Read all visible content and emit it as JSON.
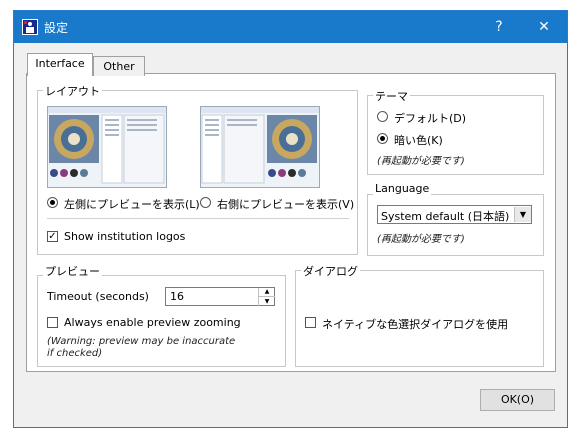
{
  "window": {
    "title": "設定",
    "help_label": "?",
    "close_label": "✕"
  },
  "tabs": [
    {
      "label": "Interface",
      "active": true
    },
    {
      "label": "Other",
      "active": false
    }
  ],
  "layout": {
    "legend": "レイアウト",
    "option_left": "左側にプレビューを表示(L)",
    "option_right": "右側にプレビューを表示(V)",
    "selected": "left",
    "show_logos_label": "Show institution logos",
    "show_logos_checked": true
  },
  "theme": {
    "legend": "テーマ",
    "option_default": "デフォルト(D)",
    "option_dark": "暗い色(K)",
    "selected": "dark",
    "restart_note": "(再起動が必要です)"
  },
  "language": {
    "legend": "Language",
    "selected_value": "System default (日本語)",
    "restart_note": "(再起動が必要です)"
  },
  "preview": {
    "legend": "プレビュー",
    "timeout_label": "Timeout (seconds)",
    "timeout_value": "16",
    "zoom_label": "Always enable preview zooming",
    "zoom_checked": false,
    "warning_line1": "(Warning: preview may be inaccurate",
    "warning_line2": "if checked)"
  },
  "dialog": {
    "legend": "ダイアログ",
    "native_picker_label": "ネイティブな色選択ダイアログを使用",
    "native_picker_checked": false
  },
  "footer": {
    "ok_label": "OK(O)"
  },
  "colors": {
    "titlebar": "#1979ca",
    "accent": "#2b79d4"
  },
  "icons": {
    "app": "app-icon",
    "help": "help-icon",
    "close": "close-icon",
    "dropdown": "chevron-down-icon",
    "spin_up": "spin-up-icon",
    "spin_down": "spin-down-icon"
  }
}
